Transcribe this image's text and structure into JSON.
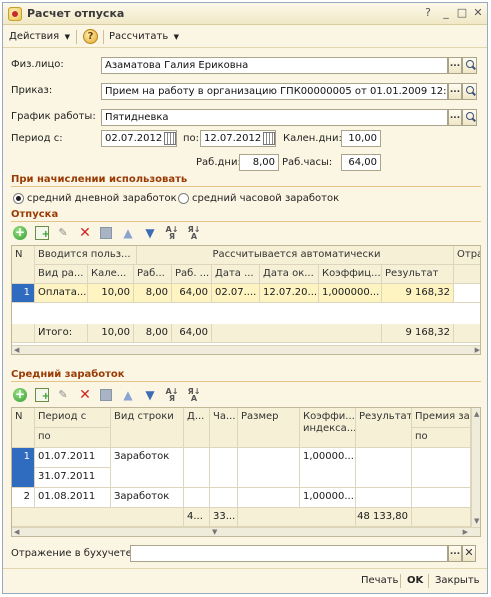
{
  "window": {
    "title": "Расчет отпуска",
    "controls": [
      "?",
      "_",
      "□",
      "✕"
    ]
  },
  "toolbar": {
    "actions_label": "Действия",
    "help_label": "?",
    "calculate_label": "Рассчитать"
  },
  "form": {
    "employee_label": "Физ.лицо:",
    "employee_value": "Азаматова Галия Ериковна",
    "order_label": "Приказ:",
    "order_value": "Прием на работу в организацию ГПК00000005 от 01.01.2009 12:00:03",
    "schedule_label": "График работы:",
    "schedule_value": "Пятидневка",
    "period_label": "Период с:",
    "period_from": "02.07.2012",
    "period_to_label": "по:",
    "period_to": "12.07.2012",
    "cal_days_label": "Кален.дни:",
    "cal_days_value": "10,00",
    "work_days_label": "Раб.дни:",
    "work_days_value": "8,00",
    "work_hours_label": "Раб.часы:",
    "work_hours_value": "64,00"
  },
  "accrual": {
    "section_title": "При начислении использовать",
    "option_daily": "средний дневной заработок",
    "option_hourly": "средний часовой заработок",
    "selected": "daily"
  },
  "vacations": {
    "section_title": "Отпуска",
    "group_headers": [
      "N",
      "Вводится польз...",
      "Рассчитывается автоматически",
      "Отра"
    ],
    "columns": [
      "Вид ра...",
      "Кале...",
      "Раб...",
      "Раб. ...",
      "Дата ...",
      "Дата ок...",
      "Коэффиц...",
      "Результат"
    ],
    "rows": [
      {
        "n": "1",
        "type": "Оплата...",
        "cal": "10,00",
        "days": "8,00",
        "hours": "64,00",
        "date_from": "02.07....",
        "date_to": "12.07.20...",
        "coef": "1,000000...",
        "result": "9 168,32"
      }
    ],
    "totals": {
      "label": "Итого:",
      "cal": "10,00",
      "days": "8,00",
      "hours": "64,00",
      "result": "9 168,32"
    }
  },
  "avg_earnings": {
    "section_title": "Средний заработок",
    "columns": [
      "N",
      "Период с",
      "Вид строки",
      "Д...",
      "Ча...",
      "Размер",
      "Коэффи... индекса...",
      "Результат",
      "Премия за"
    ],
    "sub_columns": [
      "по",
      "по"
    ],
    "rows": [
      {
        "n": "1",
        "period_from": "01.07.2011",
        "period_to": "31.07.2011",
        "kind": "Заработок",
        "coef": "1,00000..."
      },
      {
        "n": "2",
        "period_from": "01.08.2011",
        "period_to": "",
        "kind": "Заработок",
        "coef": "1,00000..."
      }
    ],
    "totals": {
      "d": "4...",
      "ch": "33...",
      "result": "48 133,80"
    }
  },
  "footer": {
    "reflection_label": "Отражение в бухучете:",
    "reflection_value": "",
    "print_label": "Печать",
    "ok_label": "OK",
    "close_label": "Закрыть"
  }
}
